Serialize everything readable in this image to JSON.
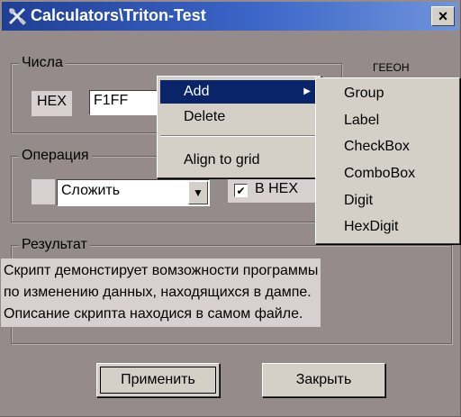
{
  "window": {
    "title": "Calculators\\Triton-Test",
    "close_glyph": "×"
  },
  "numbers_group": {
    "legend": "Числа",
    "hex_label": "HEX",
    "hex_value": "F1FF",
    "right_label": "ГЕЕОН"
  },
  "operation_group": {
    "legend": "Операция",
    "combo_value": "Сложить",
    "checkbox_label": "В HEX",
    "checkbox_checked": "✔"
  },
  "result_group": {
    "legend": "Результат",
    "description_lines": [
      "Скрипт демонстирует вомзожности программы",
      "по изменению данных, находящихся в дампе.",
      "Описание скрипта находися в самом файле."
    ]
  },
  "buttons": {
    "apply": "Применить",
    "close": "Закрыть"
  },
  "context_menu": {
    "items": [
      "Add",
      "Delete",
      "Align to grid"
    ],
    "submenu_arrow": "▶"
  },
  "submenu": {
    "items": [
      "Group",
      "Label",
      "CheckBox",
      "ComboBox",
      "Digit",
      "HexDigit"
    ]
  },
  "icons": {
    "title": "tools-icon",
    "combo_arrow": "▼"
  }
}
